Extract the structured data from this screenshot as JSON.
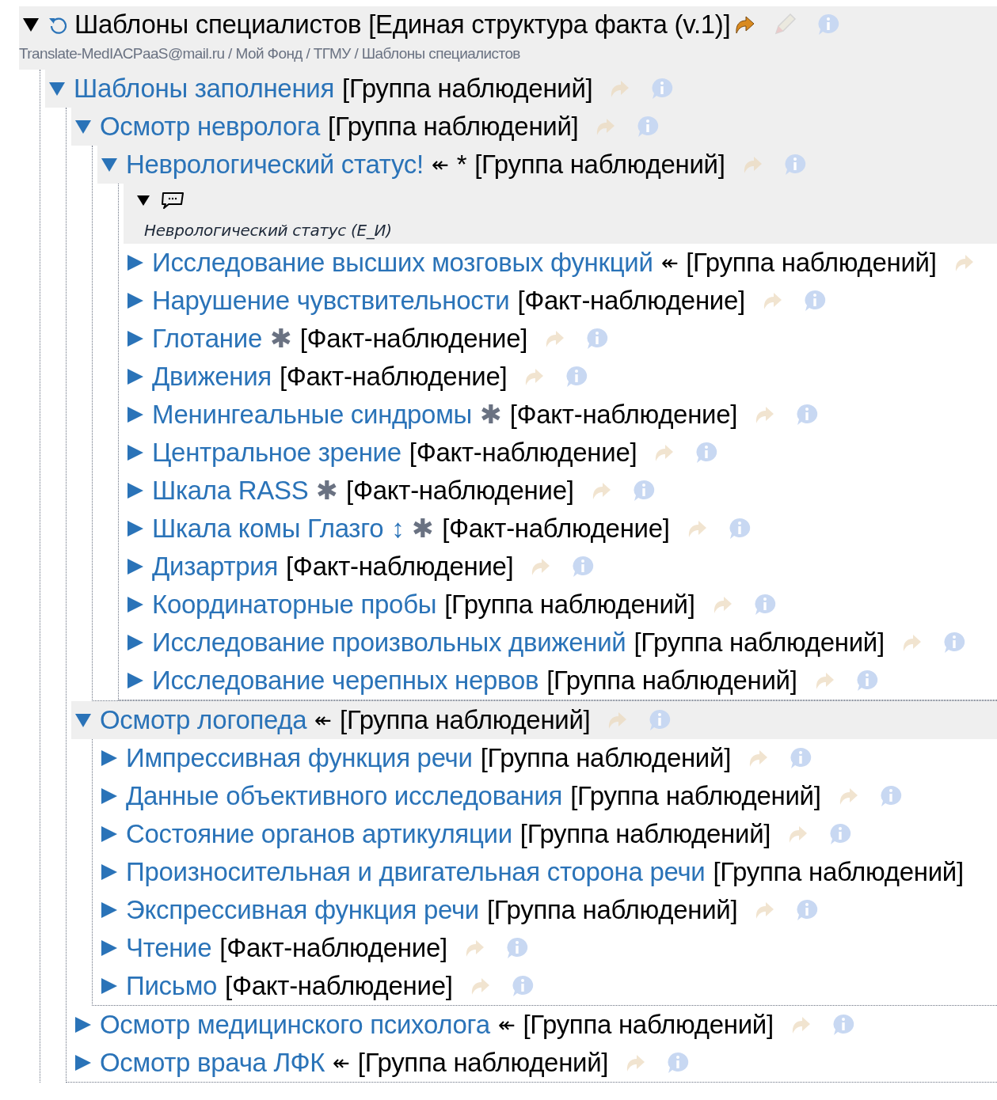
{
  "root": {
    "title": "Шаблоны специалистов [Единая структура факта (v.1)]",
    "expanded": true,
    "breadcrumb": "Translate-MedIACPaaS@mail.ru / Мой Фонд / ТГМУ  / Шаблоны специалистов"
  },
  "tree": [
    {
      "name": "Шаблоны заполнения",
      "type": "[Группа наблюдений]",
      "expanded": true,
      "children": [
        {
          "name": "Осмотр невролога",
          "type": "[Группа наблюдений]",
          "expanded": true,
          "children": [
            {
              "name": "Неврологический статус!",
              "marks": [
                {
                  "kind": "link",
                  "text": "↞"
                },
                {
                  "kind": "required",
                  "text": "*"
                }
              ],
              "type": "[Группа наблюдений]",
              "expanded": true,
              "note": {
                "expanded": true,
                "text": "Неврологический статус (Е_И)"
              },
              "children": [
                {
                  "name": "Исследование высших мозговых функций",
                  "marks": [
                    {
                      "kind": "link",
                      "text": "↞"
                    }
                  ],
                  "type": "[Группа наблюдений]",
                  "expanded": false,
                  "info_icon": false
                },
                {
                  "name": "Нарушение чувствительности",
                  "type": "[Факт-наблюдение]",
                  "expanded": false
                },
                {
                  "name": "Глотание",
                  "marks": [
                    {
                      "kind": "multi",
                      "text": "✱"
                    }
                  ],
                  "type": "[Факт-наблюдение]",
                  "expanded": false
                },
                {
                  "name": "Движения",
                  "type": "[Факт-наблюдение]",
                  "expanded": false
                },
                {
                  "name": "Менингеальные синдромы",
                  "marks": [
                    {
                      "kind": "multi",
                      "text": "✱"
                    }
                  ],
                  "type": "[Факт-наблюдение]",
                  "expanded": false
                },
                {
                  "name": "Центральное зрение",
                  "type": "[Факт-наблюдение]",
                  "expanded": false
                },
                {
                  "name": "Шкала RASS",
                  "marks": [
                    {
                      "kind": "multi",
                      "text": "✱"
                    }
                  ],
                  "type": "[Факт-наблюдение]",
                  "expanded": false
                },
                {
                  "name": "Шкала комы Глазго",
                  "marks": [
                    {
                      "kind": "range",
                      "text": "↕"
                    },
                    {
                      "kind": "multi",
                      "text": "✱"
                    }
                  ],
                  "type": "[Факт-наблюдение]",
                  "expanded": false
                },
                {
                  "name": "Дизартрия",
                  "type": "[Факт-наблюдение]",
                  "expanded": false
                },
                {
                  "name": "Координаторные пробы",
                  "type": "[Группа наблюдений]",
                  "expanded": false
                },
                {
                  "name": "Исследование произвольных движений",
                  "type": "[Группа наблюдений]",
                  "expanded": false
                },
                {
                  "name": "Исследование черепных нервов",
                  "type": "[Группа наблюдений]",
                  "expanded": false
                }
              ]
            }
          ]
        },
        {
          "name": "Осмотр логопеда",
          "marks": [
            {
              "kind": "link",
              "text": "↞"
            }
          ],
          "type": "[Группа наблюдений]",
          "expanded": true,
          "children": [
            {
              "name": "Импрессивная функция речи",
              "type": "[Группа наблюдений]",
              "expanded": false
            },
            {
              "name": "Данные объективного исследования",
              "type": "[Группа наблюдений]",
              "expanded": false
            },
            {
              "name": "Состояние органов артикуляции",
              "type": "[Группа наблюдений]",
              "expanded": false
            },
            {
              "name": "Произносительная и двигательная сторона речи",
              "type": "[Группа наблюдений]",
              "expanded": false,
              "arrow_icon": false,
              "info_icon": false
            },
            {
              "name": "Экспрессивная функция речи",
              "type": "[Группа наблюдений]",
              "expanded": false
            },
            {
              "name": "Чтение",
              "type": "[Факт-наблюдение]",
              "expanded": false
            },
            {
              "name": "Письмо",
              "type": "[Факт-наблюдение]",
              "expanded": false
            }
          ]
        },
        {
          "name": "Осмотр медицинского психолога",
          "marks": [
            {
              "kind": "link",
              "text": "↞"
            }
          ],
          "type": "[Группа наблюдений]",
          "expanded": false
        },
        {
          "name": "Осмотр врача ЛФК",
          "marks": [
            {
              "kind": "link",
              "text": "↞"
            }
          ],
          "type": "[Группа наблюдений]",
          "expanded": false
        }
      ]
    }
  ]
}
